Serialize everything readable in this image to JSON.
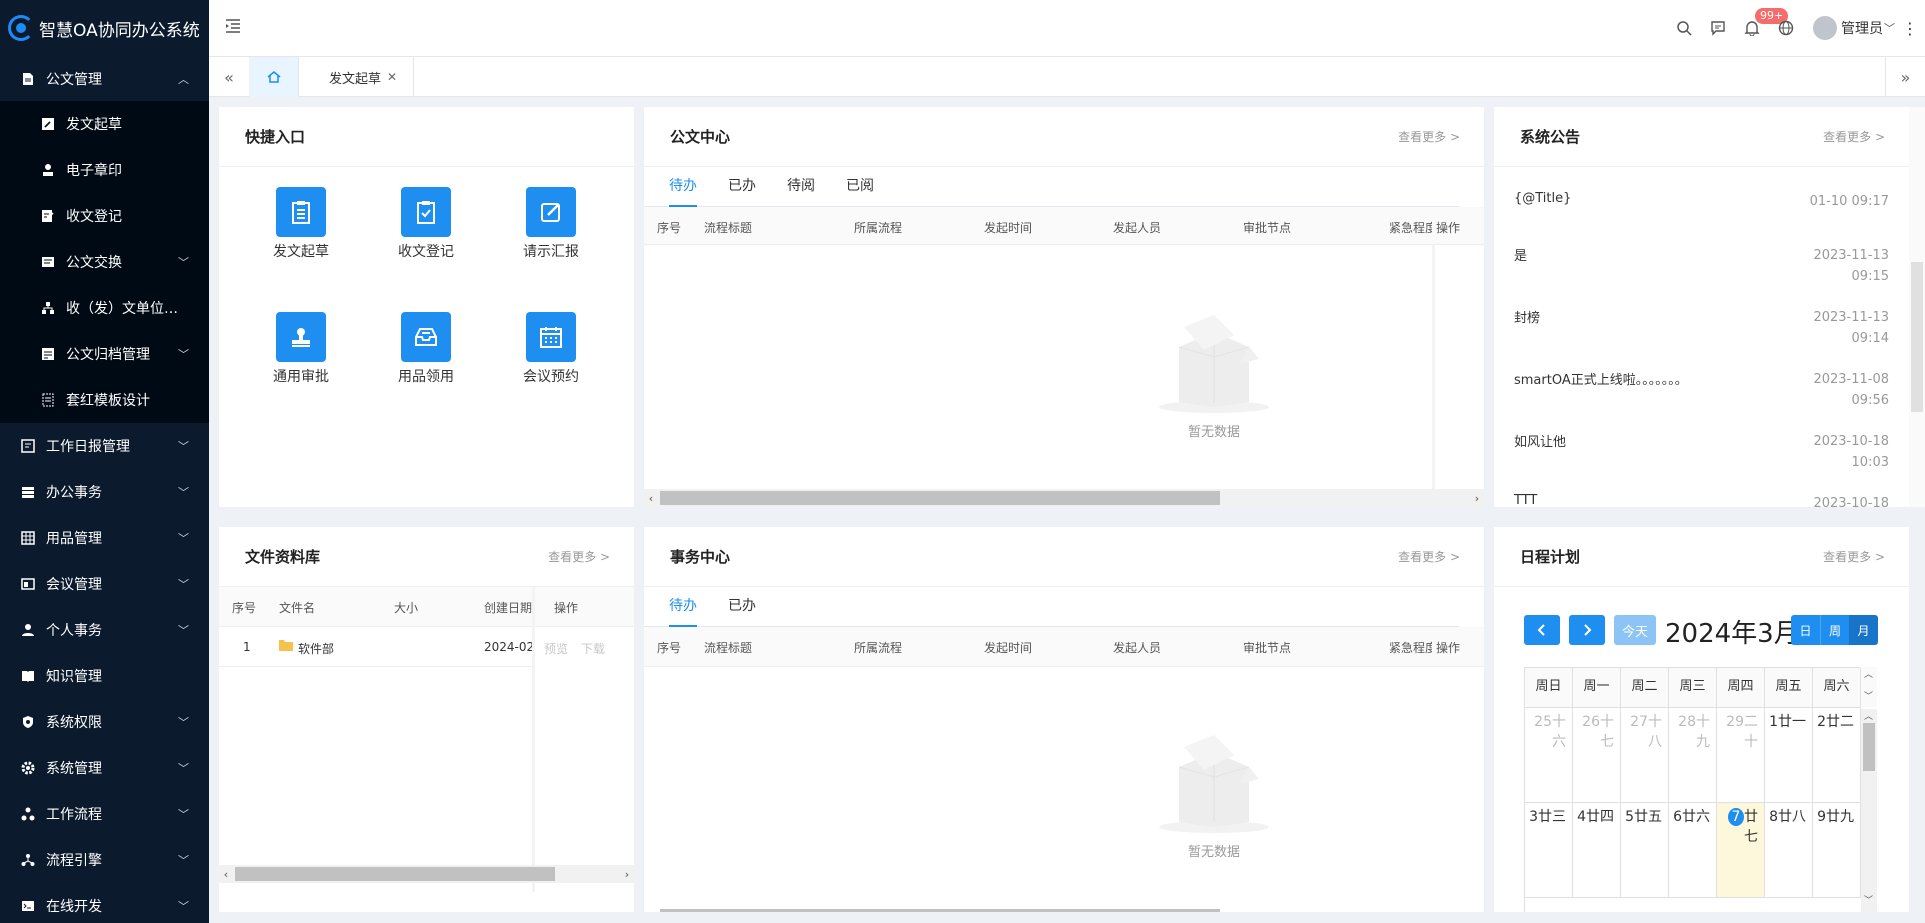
{
  "app": {
    "title": "智慧OA协同办公系统"
  },
  "sidebar": {
    "items": [
      {
        "label": "公文管理",
        "icon": "document-icon",
        "expanded": true
      },
      {
        "label": "工作日报管理",
        "icon": "report-icon"
      },
      {
        "label": "办公事务",
        "icon": "list-icon"
      },
      {
        "label": "用品管理",
        "icon": "grid-icon"
      },
      {
        "label": "会议管理",
        "icon": "meeting-icon"
      },
      {
        "label": "个人事务",
        "icon": "user-icon"
      },
      {
        "label": "知识管理",
        "icon": "book-icon"
      },
      {
        "label": "系统权限",
        "icon": "shield-icon"
      },
      {
        "label": "系统管理",
        "icon": "gear-icon"
      },
      {
        "label": "工作流程",
        "icon": "flow-icon"
      },
      {
        "label": "流程引擎",
        "icon": "engine-icon"
      },
      {
        "label": "在线开发",
        "icon": "terminal-icon"
      }
    ],
    "sub_items": [
      {
        "label": "发文起草",
        "icon": "edit-icon"
      },
      {
        "label": "电子章印",
        "icon": "stamp-icon"
      },
      {
        "label": "收文登记",
        "icon": "register-icon"
      },
      {
        "label": "公文交换",
        "icon": "exchange-icon",
        "has_children": true
      },
      {
        "label": "收（发）文单位管理",
        "icon": "org-icon"
      },
      {
        "label": "公文归档管理",
        "icon": "archive-icon",
        "has_children": true
      },
      {
        "label": "套红模板设计",
        "icon": "template-icon"
      }
    ]
  },
  "header": {
    "badge": "99+",
    "username": "管理员"
  },
  "tabbar": {
    "tabs": [
      {
        "label": "发文起草"
      }
    ]
  },
  "quick": {
    "title": "快捷入口",
    "items": [
      {
        "label": "发文起草"
      },
      {
        "label": "收文登记"
      },
      {
        "label": "请示汇报"
      },
      {
        "label": "通用审批"
      },
      {
        "label": "用品领用"
      },
      {
        "label": "会议预约"
      }
    ]
  },
  "doc_center": {
    "title": "公文中心",
    "more": "查看更多 >",
    "tabs": [
      "待办",
      "已办",
      "待阅",
      "已阅"
    ],
    "columns": [
      "序号",
      "流程标题",
      "所属流程",
      "发起时间",
      "发起人员",
      "审批节点",
      "紧急程度",
      "操作"
    ],
    "empty": "暂无数据"
  },
  "notice": {
    "title": "系统公告",
    "more": "查看更多 >",
    "rows": [
      {
        "title": "{@Title}",
        "time": "01-10 09:17"
      },
      {
        "title": "是",
        "time": "2023-11-13 09:15"
      },
      {
        "title": "封榜",
        "time": "2023-11-13 09:14"
      },
      {
        "title": "smartOA正式上线啦。。。。。。。",
        "time": "2023-11-08 09:56"
      },
      {
        "title": "如风让他",
        "time": "2023-10-18 10:03"
      },
      {
        "title": "TTT",
        "time": "2023-10-18"
      }
    ]
  },
  "files": {
    "title": "文件资料库",
    "more": "查看更多 >",
    "columns": [
      "序号",
      "文件名",
      "大小",
      "创建日期",
      "操作"
    ],
    "rows": [
      {
        "no": "1",
        "name": "软件部",
        "size": "",
        "date": "2024-02-",
        "preview": "预览",
        "download": "下载"
      }
    ]
  },
  "affairs": {
    "title": "事务中心",
    "more": "查看更多 >",
    "tabs": [
      "待办",
      "已办"
    ],
    "columns": [
      "序号",
      "流程标题",
      "所属流程",
      "发起时间",
      "发起人员",
      "审批节点",
      "紧急程度",
      "操作"
    ],
    "empty": "暂无数据"
  },
  "schedule": {
    "title": "日程计划",
    "more": "查看更多 >",
    "today_btn": "今天",
    "month_title": "2024年3月",
    "views": [
      "日",
      "周",
      "月"
    ],
    "weekdays": [
      "周日",
      "周一",
      "周二",
      "周三",
      "周四",
      "周五",
      "周六"
    ],
    "weeks": [
      [
        {
          "d": "25",
          "l": "十六",
          "m": true
        },
        {
          "d": "26",
          "l": "十七",
          "m": true
        },
        {
          "d": "27",
          "l": "十八",
          "m": true
        },
        {
          "d": "28",
          "l": "十九",
          "m": true
        },
        {
          "d": "29",
          "l": "二十",
          "m": true
        },
        {
          "d": "1",
          "l": "廿一"
        },
        {
          "d": "2",
          "l": "廿二"
        }
      ],
      [
        {
          "d": "3",
          "l": "廿三"
        },
        {
          "d": "4",
          "l": "廿四"
        },
        {
          "d": "5",
          "l": "廿五"
        },
        {
          "d": "6",
          "l": "廿六"
        },
        {
          "d": "7",
          "l": "廿七",
          "today": true
        },
        {
          "d": "8",
          "l": "廿八"
        },
        {
          "d": "9",
          "l": "廿九"
        }
      ]
    ]
  },
  "colors": {
    "sidebar": "#0c1a2e",
    "accent": "#1e8ff0",
    "badge": "#f56c6c"
  }
}
